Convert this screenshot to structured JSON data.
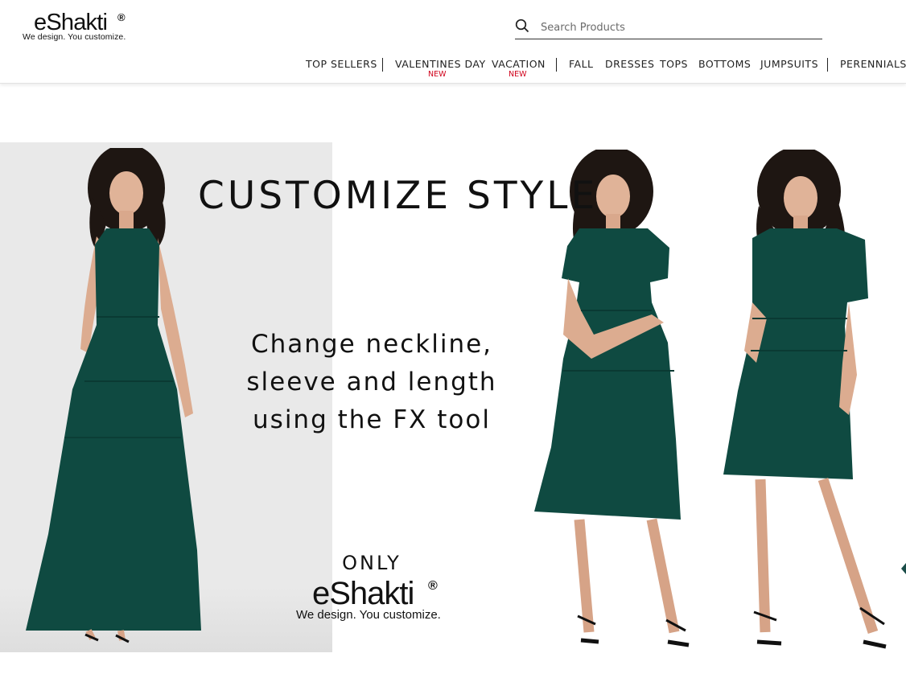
{
  "header": {
    "logo": {
      "word": "eShakti",
      "reg": "®",
      "tagline": "We design. You customize."
    },
    "search": {
      "placeholder": "Search Products",
      "value": ""
    },
    "nav": [
      {
        "label": "TOP SELLERS",
        "badge": ""
      },
      {
        "label": "VALENTINES DAY",
        "badge": "NEW"
      },
      {
        "label": "VACATION",
        "badge": "NEW"
      },
      {
        "label": "FALL",
        "badge": ""
      },
      {
        "label": "DRESSES",
        "badge": ""
      },
      {
        "label": "TOPS",
        "badge": ""
      },
      {
        "label": "BOTTOMS",
        "badge": ""
      },
      {
        "label": "JUMPSUITS",
        "badge": ""
      },
      {
        "label": "PERENNIALS",
        "badge": ""
      }
    ]
  },
  "hero": {
    "title": "CUSTOMIZE STYLE",
    "subtitle_lines": [
      "Change neckline,",
      "sleeve and length",
      "using the FX tool"
    ],
    "only": "ONLY",
    "logo": {
      "word": "eShakti",
      "reg": "®",
      "tagline": "We design. You customize."
    },
    "images": [
      "sleeveless-midi-dress-model",
      "cap-sleeve-v-neck-dress-model",
      "puff-sleeve-knee-dress-model"
    ]
  },
  "colors": {
    "accent_badge": "#d0021b",
    "dress_green": "#0f4a41",
    "panel_grey": "#e9e9e9"
  }
}
